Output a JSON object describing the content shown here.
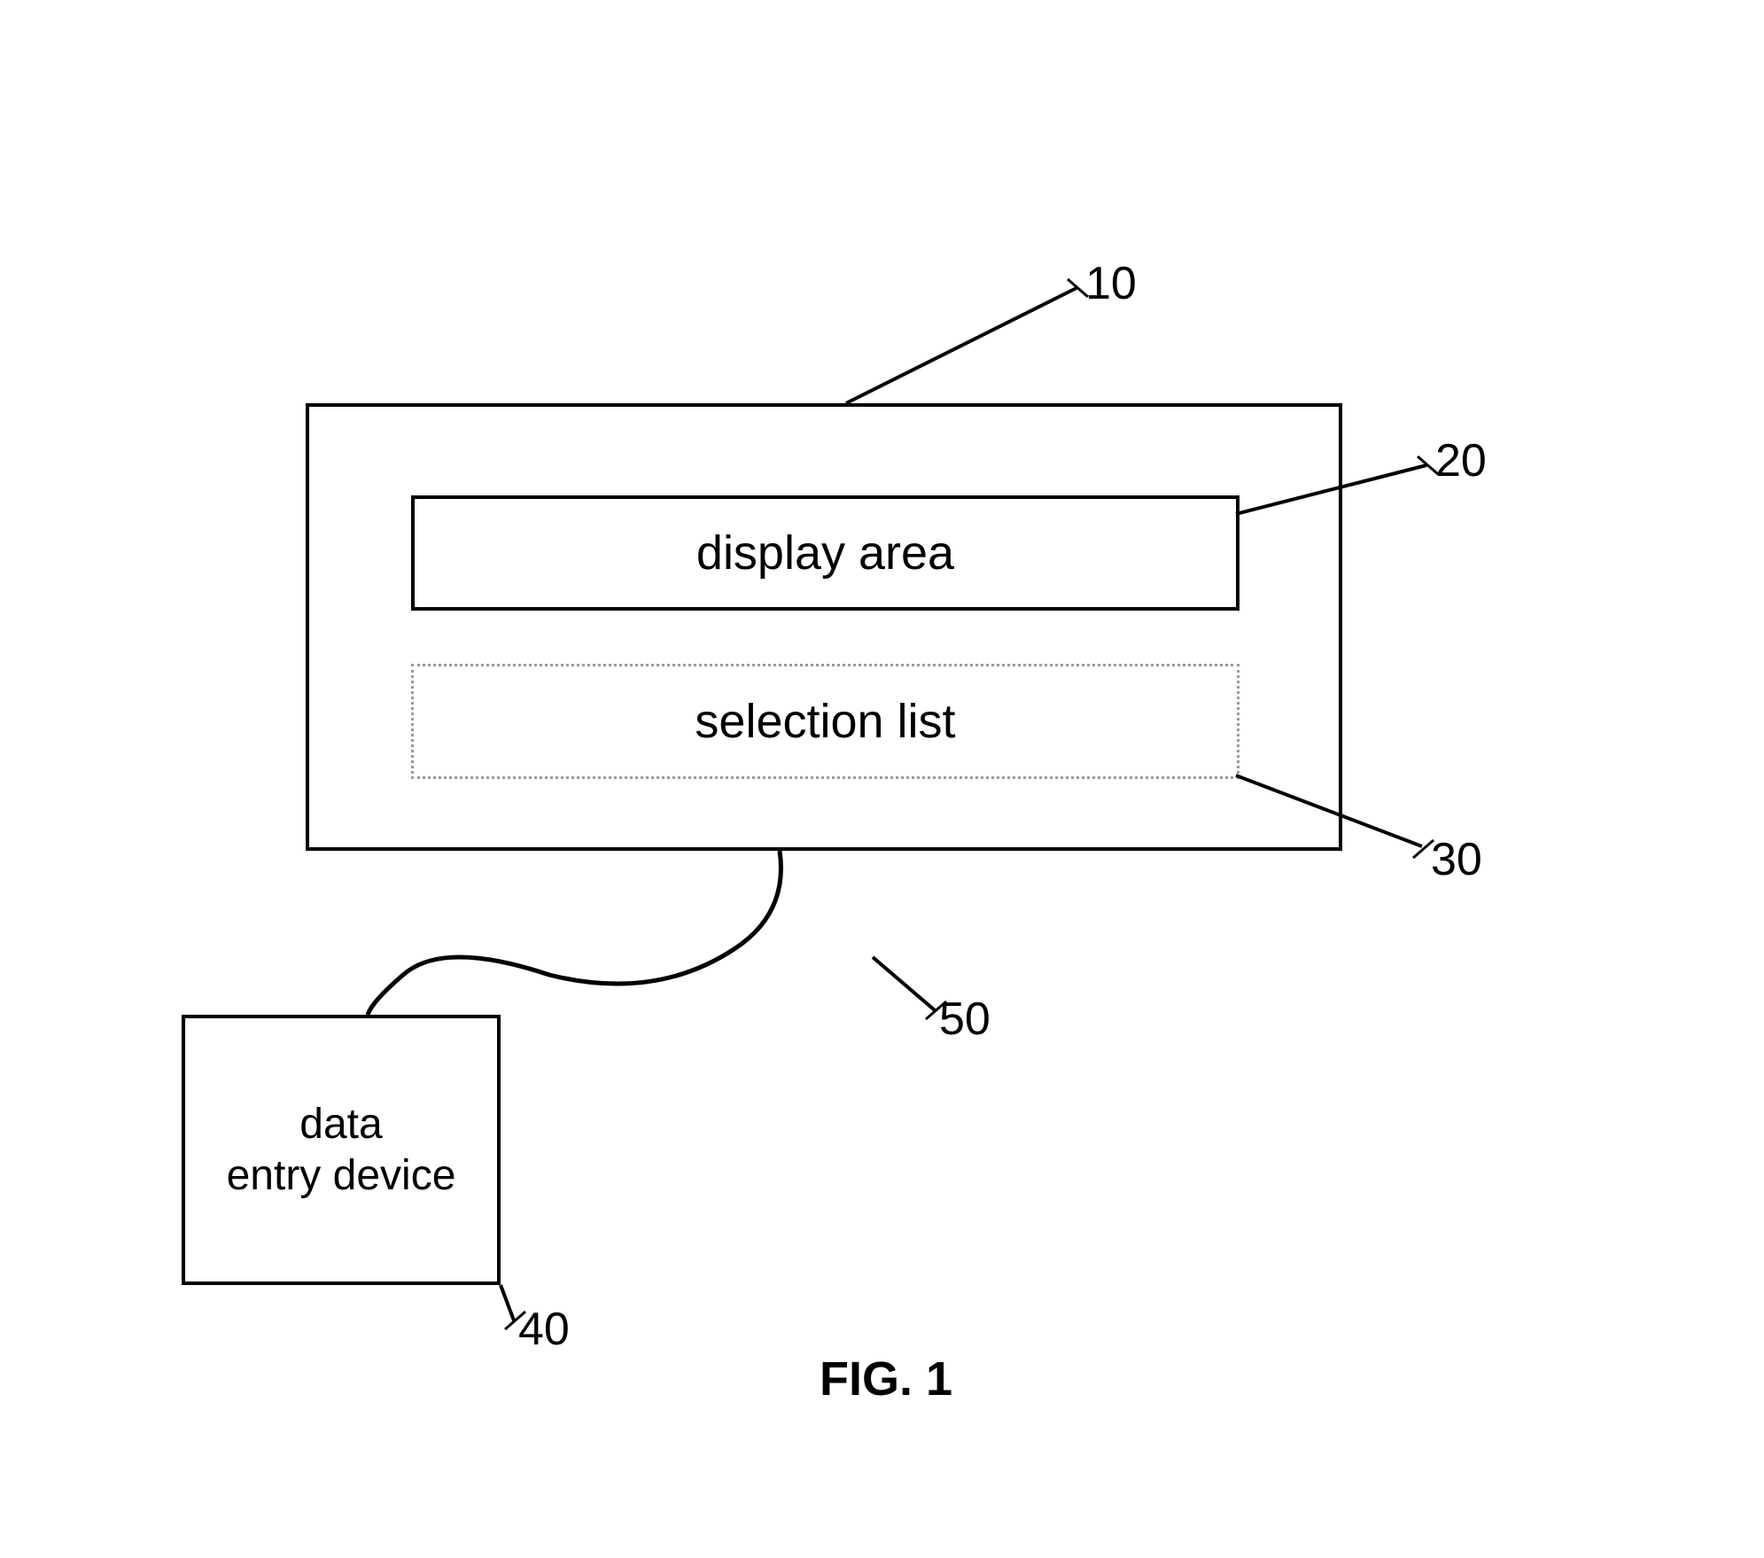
{
  "diagram": {
    "display_area_label": "display area",
    "selection_list_label": "selection list",
    "data_entry_device_label": "data\nentry device",
    "ref_10": "10",
    "ref_20": "20",
    "ref_30": "30",
    "ref_40": "40",
    "ref_50": "50",
    "figure_label": "FIG. 1"
  }
}
